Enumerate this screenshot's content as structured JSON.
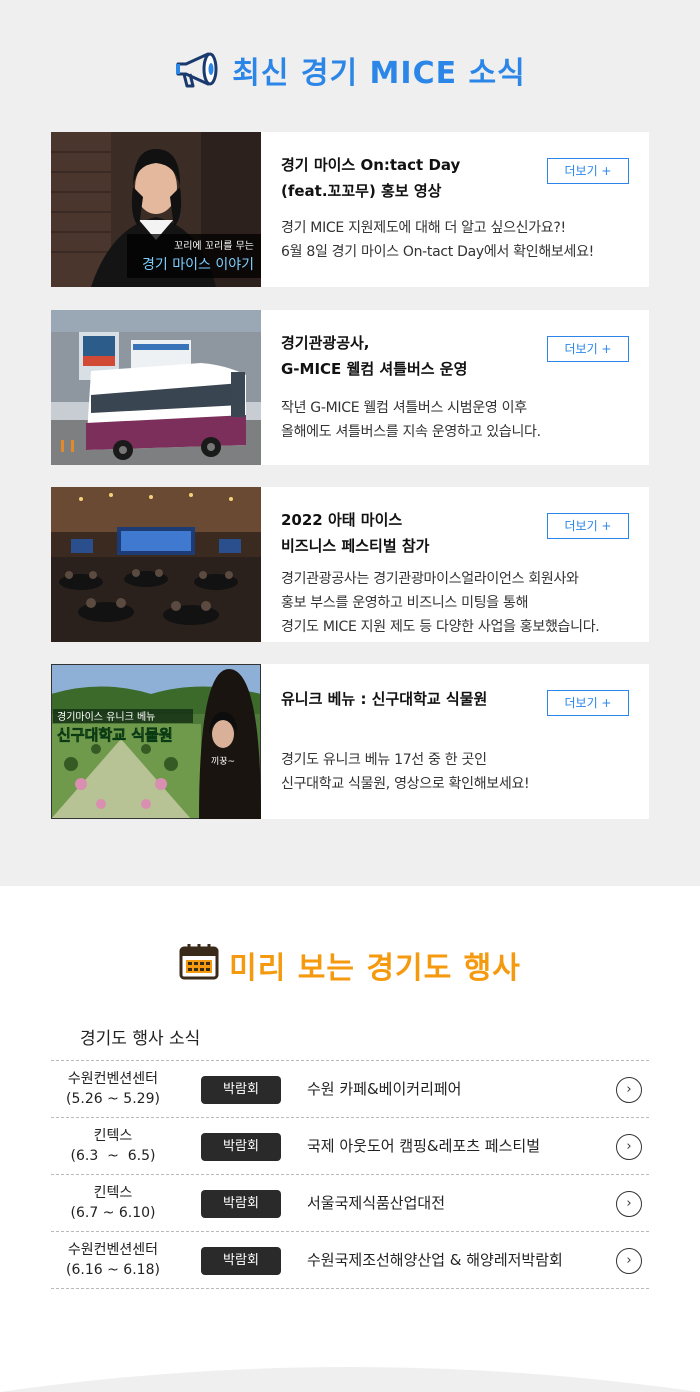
{
  "news": {
    "title": "최신 경기 MICE 소식",
    "title_icon": "megaphone-icon",
    "accent": "#2b86e8",
    "background": "#efefef",
    "cards": [
      {
        "title": "경기 마이스 On:tact Day\n(feat.꼬꼬무) 홍보 영상",
        "more": "더보기 +",
        "desc": "경기 MICE 지원제도에 대해 더 알고 싶으신가요?!\n6월 8일 경기 마이스 On-tact Day에서 확인해보세요!",
        "thumb_caption_top": "꼬리에 꼬리를 무는",
        "thumb_caption_main": "경기 마이스 이야기"
      },
      {
        "title": "경기관광공사,\nG-MICE 웰컴 셔틀버스 운영",
        "more": "더보기 +",
        "desc": "작년 G-MICE 웰컴 셔틀버스 시범운영 이후\n올해에도 셔틀버스를 지속 운영하고 있습니다."
      },
      {
        "title": "2022 아태 마이스\n비즈니스 페스티벌 참가",
        "more": "더보기 +",
        "desc": "경기관광공사는 경기관광마이스얼라이언스 회원사와\n홍보 부스를 운영하고 비즈니스 미팅을 통해\n경기도 MICE 지원 제도 등 다양한 사업을 홍보했습니다."
      },
      {
        "title": "유니크 베뉴 : 신구대학교 식물원",
        "more": "더보기 +",
        "desc": "경기도 유니크 베뉴 17선 중 한 곳인\n신구대학교 식물원, 영상으로 확인해보세요!",
        "thumb_caption_top": "경기마이스 유니크 베뉴",
        "thumb_caption_main": "신구대학교 식물원",
        "thumb_bubble": "끼꿍~"
      }
    ]
  },
  "events": {
    "title": "미리 보는 경기도 행사",
    "title_icon": "calendar-icon",
    "accent": "#f59a0f",
    "subheading": "경기도 행사 소식",
    "rows": [
      {
        "venue": "수원컨벤션센터",
        "date": "(5.26 ~ 5.29)",
        "type": "박람회",
        "name": "수원 카페&베이커리페어",
        "arrow": "›"
      },
      {
        "venue": "킨텍스",
        "date": "(6.3  ~  6.5)",
        "type": "박람회",
        "name": "국제 아웃도어 캠핑&레포츠 페스티벌",
        "arrow": "›"
      },
      {
        "venue": "킨텍스",
        "date": "(6.7 ~ 6.10)",
        "type": "박람회",
        "name": "서울국제식품산업대전",
        "arrow": "›"
      },
      {
        "venue": "수원컨벤션센터",
        "date": "(6.16 ~ 6.18)",
        "type": "박람회",
        "name": "수원국제조선해양산업 & 해양레저박람회",
        "arrow": "›"
      }
    ]
  }
}
